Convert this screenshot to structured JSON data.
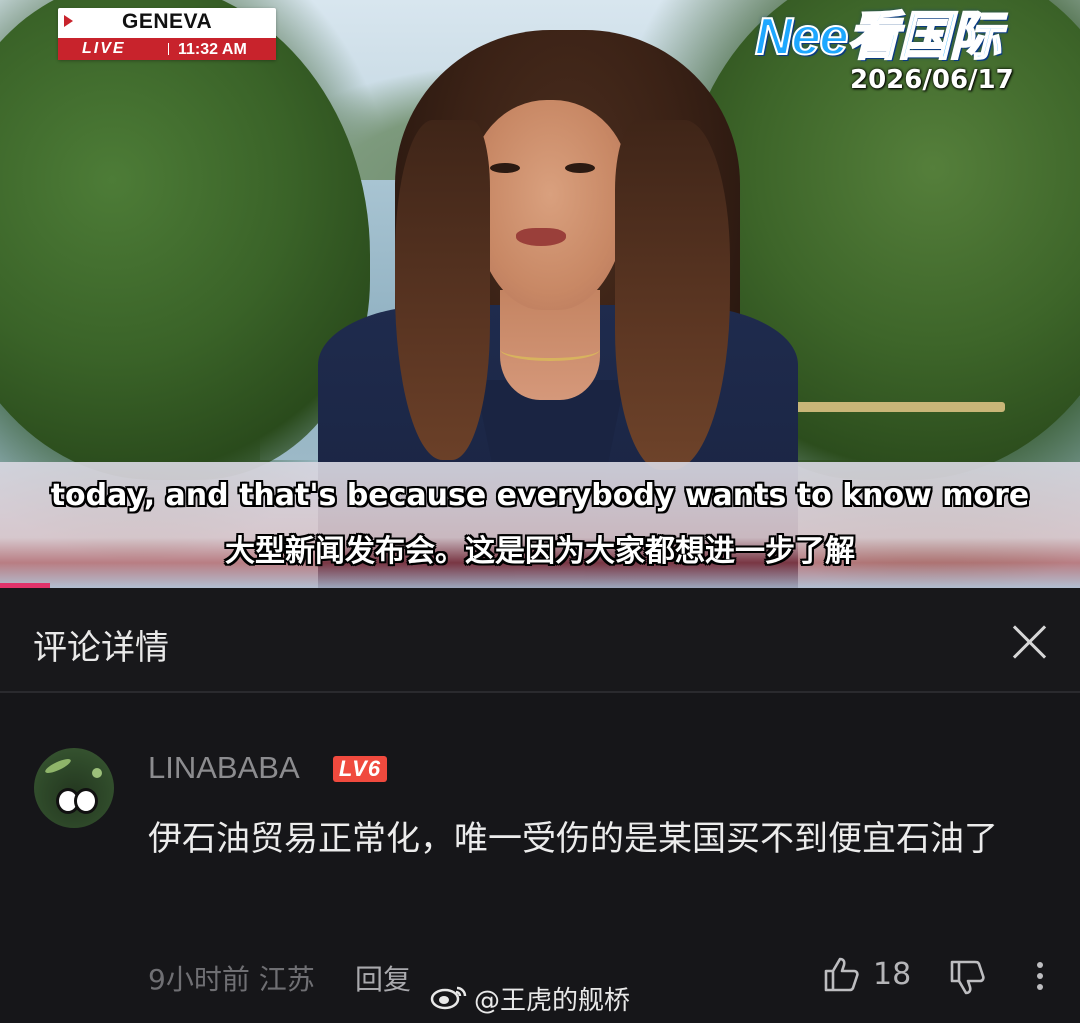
{
  "video": {
    "location": "GENEVA",
    "live_label": "LIVE",
    "time": "11:32 AM",
    "channel_logo": "Nee看国际",
    "date": "2026/06/17",
    "subtitle_en": "today, and that's because everybody wants to know more",
    "subtitle_zh": "大型新闻发布会。这是因为大家都想进一步了解",
    "colors": {
      "live_red": "#c8232c",
      "logo_blue": "#1ea7ff",
      "progress": "#e1336b"
    }
  },
  "panel": {
    "title": "评论详情",
    "close_icon": "close-icon"
  },
  "comment": {
    "username": "LINABABA",
    "level": "LV6",
    "text": "伊石油贸易正常化，唯一受伤的是某国买不到便宜石油了",
    "time_location": "9小时前 江苏",
    "reply_label": "回复",
    "like_count": "18",
    "icons": [
      "like-icon",
      "dislike-icon",
      "more-icon"
    ],
    "level_color": "#f04a3e"
  },
  "watermark": {
    "text": "@王虎的舰桥",
    "icon": "weibo-icon"
  }
}
